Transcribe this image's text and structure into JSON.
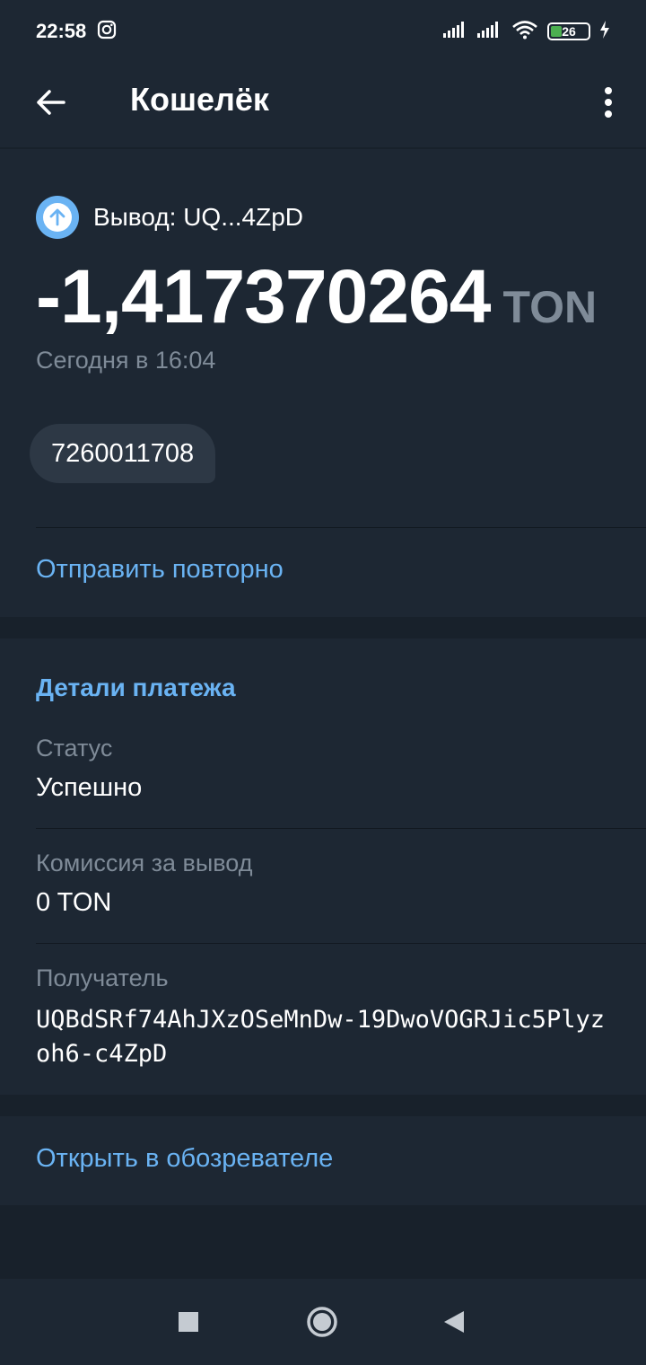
{
  "status_bar": {
    "time": "22:58",
    "battery": "26"
  },
  "toolbar": {
    "title": "Кошелёк"
  },
  "transaction": {
    "label": "Вывод: UQ...4ZpD",
    "amount": "-1,417370264",
    "currency": "TON",
    "date": "Сегодня в 16:04",
    "comment": "7260011708",
    "resend_label": "Отправить повторно"
  },
  "details": {
    "title": "Детали платежа",
    "status_label": "Статус",
    "status_value": "Успешно",
    "fee_label": "Комиссия за вывод",
    "fee_value": "0 TON",
    "recipient_label": "Получатель",
    "recipient_value": "UQBdSRf74AhJXzOSeMnDw-19DwoVOGRJic5Plyzoh6-c4ZpD"
  },
  "actions": {
    "open_explorer": "Открыть в обозревателе"
  },
  "colors": {
    "background": "#1d2733",
    "accent": "#6ab3f3",
    "muted": "#7f8b98"
  }
}
